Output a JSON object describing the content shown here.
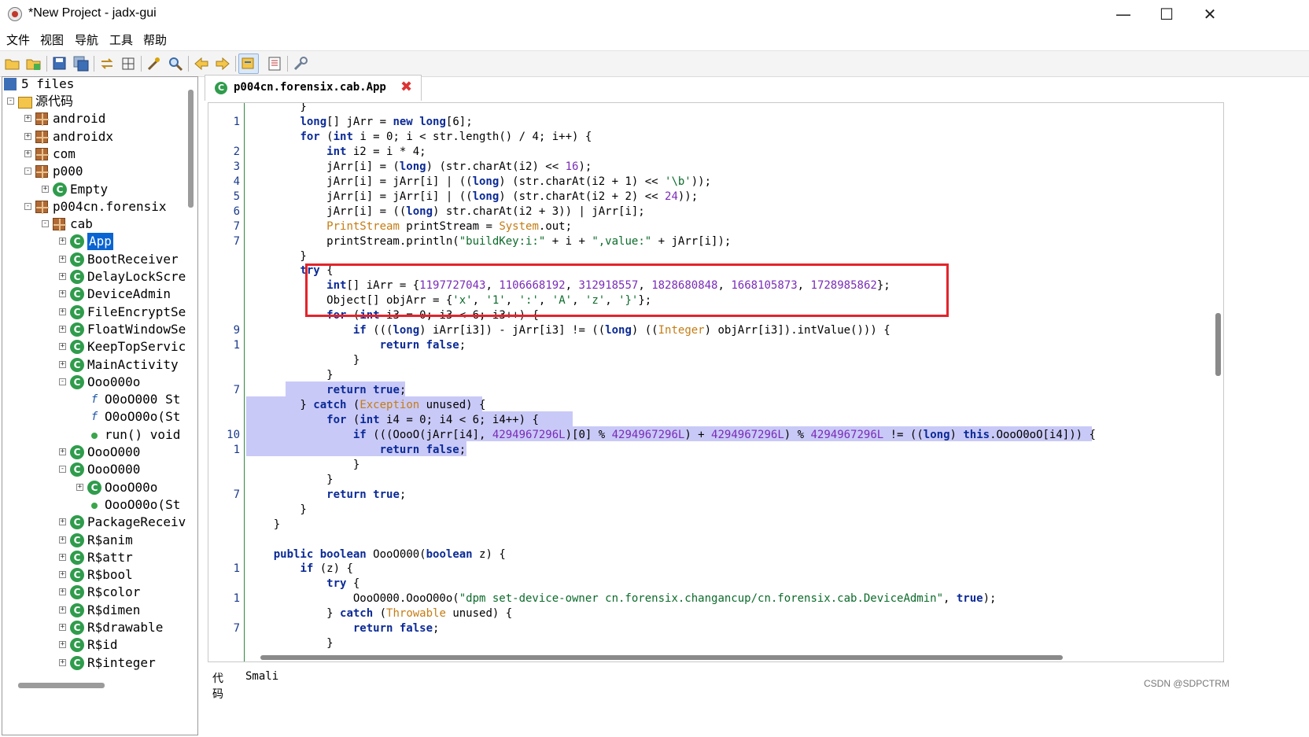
{
  "window": {
    "title": "*New Project - jadx-gui",
    "minimize": "—",
    "maximize": "☐",
    "close": "✕"
  },
  "menu": [
    "文件",
    "视图",
    "导航",
    "工具",
    "帮助"
  ],
  "toolbar_icons": [
    "open-folder-icon",
    "add-files-icon",
    "save-icon",
    "save-all-icon",
    "sync-icon",
    "flatten-icon",
    "decompile-icon",
    "search-icon",
    "back-icon",
    "forward-icon",
    "deobfuscation-icon",
    "log-icon",
    "preferences-icon"
  ],
  "tree": {
    "root_label": "5 files",
    "items": [
      {
        "label": "源代码",
        "kind": "folder"
      },
      {
        "label": "android",
        "kind": "package"
      },
      {
        "label": "androidx",
        "kind": "package"
      },
      {
        "label": "com",
        "kind": "package"
      },
      {
        "label": "p000",
        "kind": "package"
      },
      {
        "label": "Empty",
        "kind": "class"
      },
      {
        "label": "p004cn.forensix",
        "kind": "package"
      },
      {
        "label": "cab",
        "kind": "package"
      },
      {
        "label": "App",
        "kind": "class",
        "selected": true
      },
      {
        "label": "BootReceiver",
        "kind": "class"
      },
      {
        "label": "DelayLockScre",
        "kind": "class"
      },
      {
        "label": "DeviceAdmin",
        "kind": "class"
      },
      {
        "label": "FileEncryptSe",
        "kind": "class"
      },
      {
        "label": "FloatWindowSe",
        "kind": "class"
      },
      {
        "label": "KeepTopServic",
        "kind": "class"
      },
      {
        "label": "MainActivity",
        "kind": "class"
      },
      {
        "label": "Ooo000o",
        "kind": "class"
      },
      {
        "label": "O0oO000 St",
        "kind": "field"
      },
      {
        "label": "O0oO00o(St",
        "kind": "field"
      },
      {
        "label": "run() void",
        "kind": "method"
      },
      {
        "label": "OooO000",
        "kind": "class"
      },
      {
        "label": "OooO000",
        "kind": "class"
      },
      {
        "label": "OooO00o",
        "kind": "class"
      },
      {
        "label": "OooO00o(St",
        "kind": "method"
      },
      {
        "label": "PackageReceiv",
        "kind": "class"
      },
      {
        "label": "R$anim",
        "kind": "class"
      },
      {
        "label": "R$attr",
        "kind": "class"
      },
      {
        "label": "R$bool",
        "kind": "class"
      },
      {
        "label": "R$color",
        "kind": "class"
      },
      {
        "label": "R$dimen",
        "kind": "class"
      },
      {
        "label": "R$drawable",
        "kind": "class"
      },
      {
        "label": "R$id",
        "kind": "class"
      },
      {
        "label": "R$integer",
        "kind": "class"
      }
    ]
  },
  "editor": {
    "tab_label": "p004cn.forensix.cab.App",
    "lines": [
      {
        "n": "",
        "t": "        }"
      },
      {
        "n": "1",
        "t": "        long[] jArr = new long[6];"
      },
      {
        "n": "",
        "t": "        for (int i = 0; i < str.length() / 4; i++) {"
      },
      {
        "n": "2",
        "t": "            int i2 = i * 4;"
      },
      {
        "n": "3",
        "t": "            jArr[i] = (long) (str.charAt(i2) << 16);"
      },
      {
        "n": "4",
        "t": "            jArr[i] = jArr[i] | ((long) (str.charAt(i2 + 1) << '\\b'));"
      },
      {
        "n": "5",
        "t": "            jArr[i] = jArr[i] | ((long) (str.charAt(i2 + 2) << 24));"
      },
      {
        "n": "6",
        "t": "            jArr[i] = ((long) str.charAt(i2 + 3)) | jArr[i];"
      },
      {
        "n": "7",
        "t": "            PrintStream printStream = System.out;"
      },
      {
        "n": "7",
        "t": "            printStream.println(\"buildKey:i:\" + i + \",value:\" + jArr[i]);"
      },
      {
        "n": "",
        "t": "        }"
      },
      {
        "n": "",
        "t": "        try {"
      },
      {
        "n": "",
        "t": "            int[] iArr = {1197727043, 1106668192, 312918557, 1828680848, 1668105873, 1728985862};"
      },
      {
        "n": "",
        "t": "            Object[] objArr = {'x', '1', ':', 'A', 'z', '}'};"
      },
      {
        "n": "",
        "t": "            for (int i3 = 0; i3 < 6; i3++) {"
      },
      {
        "n": "9",
        "t": "                if (((long) iArr[i3]) - jArr[i3] != ((long) ((Integer) objArr[i3]).intValue())) {"
      },
      {
        "n": "1",
        "t": "                    return false;"
      },
      {
        "n": "",
        "t": "                }"
      },
      {
        "n": "",
        "t": "            }"
      },
      {
        "n": "7",
        "t": "            return true;"
      },
      {
        "n": "",
        "t": "        } catch (Exception unused) {"
      },
      {
        "n": "",
        "t": "            for (int i4 = 0; i4 < 6; i4++) {"
      },
      {
        "n": "10",
        "t": "                if (((OooO(jArr[i4], 4294967296L)[0] % 4294967296L) + 4294967296L) % 4294967296L != ((long) this.OooO0oO[i4])) {"
      },
      {
        "n": "1",
        "t": "                    return false;"
      },
      {
        "n": "",
        "t": "                }"
      },
      {
        "n": "",
        "t": "            }"
      },
      {
        "n": "7",
        "t": "            return true;"
      },
      {
        "n": "",
        "t": "        }"
      },
      {
        "n": "",
        "t": "    }"
      },
      {
        "n": "",
        "t": ""
      },
      {
        "n": "",
        "t": "    public boolean OooO000(boolean z) {"
      },
      {
        "n": "1",
        "t": "        if (z) {"
      },
      {
        "n": "",
        "t": "            try {"
      },
      {
        "n": "1",
        "t": "                OooO000.OooO00o(\"dpm set-device-owner cn.forensix.changancup/cn.forensix.cab.DeviceAdmin\", true);"
      },
      {
        "n": "",
        "t": "            } catch (Throwable unused) {"
      },
      {
        "n": "7",
        "t": "                return false;"
      },
      {
        "n": "",
        "t": "            }"
      }
    ]
  },
  "bottom_tabs": [
    "代码",
    "Smali"
  ],
  "watermark": "CSDN @SDPCTRM",
  "colors": {
    "selection": "#0a64d2",
    "highlight": "#c9c9f7",
    "annotation_box": "#e3242b",
    "keyword": "#0b2a96"
  }
}
